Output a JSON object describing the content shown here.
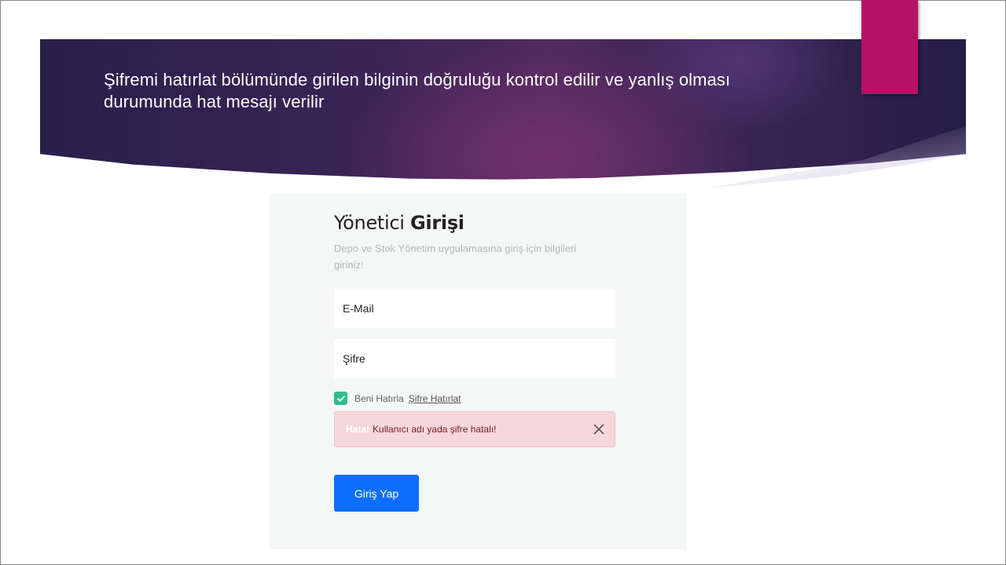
{
  "slide": {
    "title": "Şifremi hatırlat bölümünde girilen bilginin doğruluğu kontrol edilir ve yanlış olması durumunda hat mesajı verilir",
    "colors": {
      "banner": "#3a2456",
      "accent_tab": "#b51165"
    }
  },
  "login": {
    "title_light": "Yönetici",
    "title_bold": "Girişi",
    "subtitle": "Depo ve Stok Yönetim uygulamasına giriş için bilgileri giriniz!",
    "email_placeholder": "E-Mail",
    "password_placeholder": "Şifre",
    "remember_label": "Beni Hatırla",
    "remember_checked": true,
    "forgot_link": "Şifre Hatırlat",
    "alert": {
      "strong": "Hata!",
      "message": "Kullanıcı adı yada şifre hatalı!",
      "close_icon": "close-icon"
    },
    "submit_label": "Giriş Yap",
    "colors": {
      "primary": "#0d6efd",
      "check": "#2ebd8a",
      "alert_bg": "#f8d7da"
    }
  }
}
